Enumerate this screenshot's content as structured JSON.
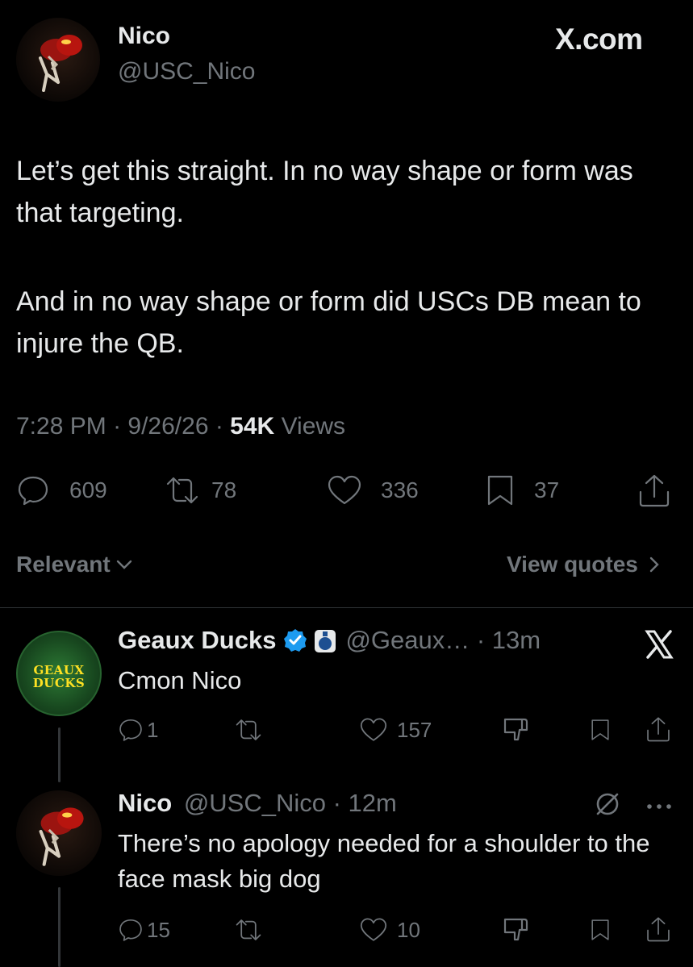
{
  "main_tweet": {
    "author_name": "Nico",
    "author_handle": "@USC_Nico",
    "site_badge": "X.com",
    "text_p1": "Let’s get this straight. In no way shape or form was that targeting.",
    "text_p2": "And in no way shape or form did USCs DB mean to injure the QB.",
    "time": "7:28 PM",
    "date": "9/26/26",
    "views_count": "54K",
    "views_label": "Views",
    "replies": "609",
    "reposts": "78",
    "likes": "336",
    "bookmarks": "37"
  },
  "sort": {
    "relevant_label": "Relevant",
    "view_quotes_label": "View quotes"
  },
  "replies": [
    {
      "author_name": "Geaux Ducks",
      "avatar_text_1": "GEAUX",
      "avatar_text_2": "DUCKS",
      "handle_time": "@Geaux… · 13m",
      "text": "Cmon Nico",
      "replies": "1",
      "reposts": "",
      "likes": "157"
    },
    {
      "author_name": "Nico",
      "handle_time": "@USC_Nico · 12m",
      "text": "There’s no apology needed for a shoulder to the face mask big dog",
      "replies": "15",
      "reposts": "",
      "likes": "10"
    }
  ],
  "colors": {
    "background": "#000000",
    "text": "#e7e9ea",
    "muted": "#71767b",
    "verified": "#1d9bf0",
    "ducks_green": "#1f5d2a",
    "ducks_yellow": "#fee123"
  }
}
